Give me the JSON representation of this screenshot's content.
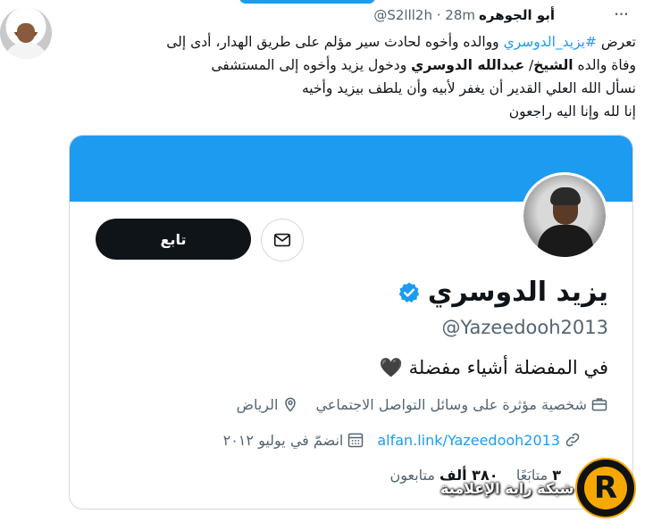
{
  "tweet": {
    "author_name": "أبو الجوهره",
    "author_handle": "@S2lll2h",
    "time": "· 28m",
    "line1_before": "تعرض ",
    "line1_hashtag": "#يزيد_الدوسري",
    "line1_after": " ووالده وأخوه لحادث سير مؤلم على طريق الهدار، أدى إلى",
    "line2_before": "وفاة والده ",
    "line2_bold1": "الشيخ",
    "line2_mid": "/ ",
    "line2_bold2": "عبدالله الدوسري",
    "line2_after": " ودخول يزيد وأخوه إلى المستشفى",
    "line3": "نسأل الله العلي القدير أن يغفر لأبيه وأن يلطف بيزيد وأخيه",
    "line4": "إنا لله وإنا اليه راجعون"
  },
  "profile_card": {
    "follow_label": "تابع",
    "display_name": "يزيد الدوسري",
    "handle": "@Yazeedooh2013",
    "bio": "في المفضلة أشياء مفضلة 🖤",
    "category": "شخصية مؤثرة على وسائل التواصل الاجتماعي",
    "location": "الرياض",
    "link": "alfan.link/Yazeedooh2013",
    "joined": "انضمّ في يوليو ٢٠١٢",
    "following_count": "٣",
    "following_label": "متابَعًا",
    "followers_count": "٣٨٠ ألف",
    "followers_label": "متابعون"
  },
  "watermark": {
    "text": "شبكة راية الإعلامية",
    "logo_letter": "R"
  },
  "colors": {
    "accent": "#1d9bf0",
    "text": "#0f1419",
    "muted": "#536471",
    "border": "#cfd9de",
    "watermark_orange": "#f6a800"
  },
  "icons": [
    "more-icon",
    "mail-icon",
    "verified-badge-icon",
    "briefcase-icon",
    "location-pin-icon",
    "link-icon",
    "calendar-icon"
  ]
}
